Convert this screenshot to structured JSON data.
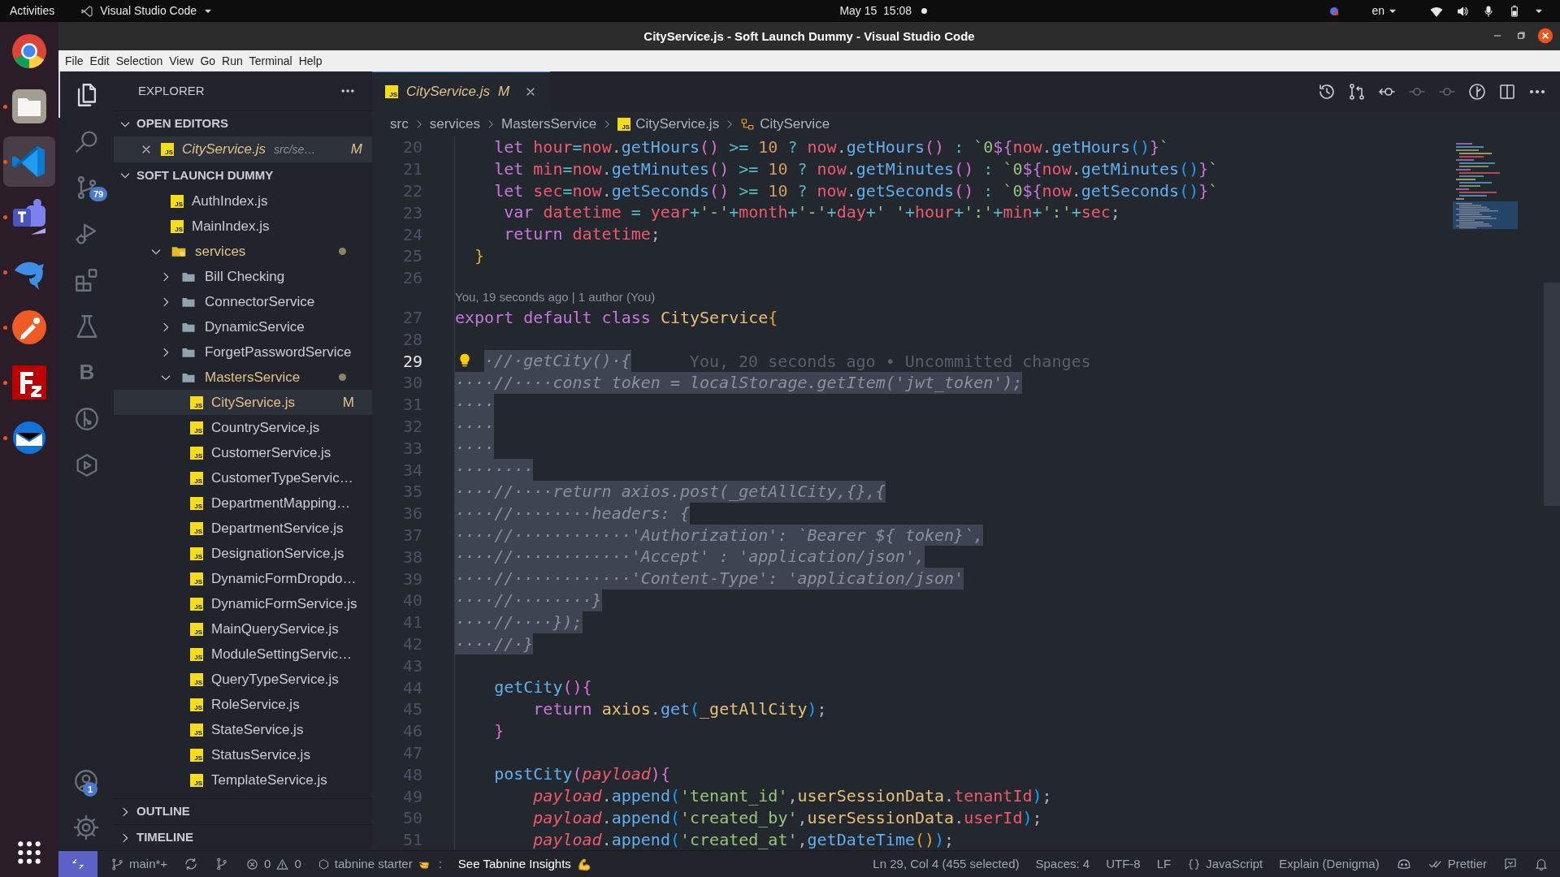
{
  "top_bar": {
    "activities": "Activities",
    "app_menu": "Visual Studio Code",
    "clock": "May 15  15:08",
    "language": "en"
  },
  "window": {
    "title": "CityService.js - Soft Launch Dummy - Visual Studio Code"
  },
  "dock": [
    {
      "kind": "browser",
      "running": false,
      "selected": false
    },
    {
      "kind": "files",
      "running": true,
      "selected": false
    },
    {
      "kind": "code",
      "running": true,
      "selected": true
    },
    {
      "kind": "chat",
      "running": true,
      "selected": false
    },
    {
      "kind": "dolphin",
      "running": true,
      "selected": false
    },
    {
      "kind": "api",
      "running": true,
      "selected": false
    },
    {
      "kind": "ftp",
      "running": true,
      "selected": false
    },
    {
      "kind": "mail",
      "running": true,
      "selected": false
    }
  ],
  "menu": [
    "File",
    "Edit",
    "Selection",
    "View",
    "Go",
    "Run",
    "Terminal",
    "Help"
  ],
  "activity_bar": [
    {
      "kind": "explorer",
      "selected": true
    },
    {
      "kind": "search",
      "selected": false
    },
    {
      "kind": "source-control",
      "selected": false,
      "badge": "79"
    },
    {
      "kind": "debug",
      "selected": false
    },
    {
      "kind": "extensions",
      "selected": false
    },
    {
      "kind": "testing",
      "selected": false
    },
    {
      "kind": "letter",
      "selected": false,
      "glyph": "B"
    },
    {
      "kind": "git-graph",
      "selected": false
    },
    {
      "kind": "hexagon",
      "selected": false
    }
  ],
  "activity_bar_bottom": [
    {
      "kind": "accounts",
      "badge": "1"
    },
    {
      "kind": "settings"
    }
  ],
  "sidebar": {
    "title": "EXPLORER",
    "open_editors": {
      "label": "OPEN EDITORS",
      "expanded": true,
      "items": [
        {
          "name": "CityService.js",
          "file_icon_text": "JS",
          "path": "src/se…",
          "status": "M",
          "selected": true
        }
      ]
    },
    "project": {
      "label": "SOFT LAUNCH DUMMY",
      "expanded": true,
      "tree": [
        {
          "kind": "file",
          "name": "AuthIndex.js",
          "file_icon_text": "JS",
          "modified": false,
          "selected": false
        },
        {
          "kind": "file",
          "name": "MainIndex.js",
          "file_icon_text": "JS",
          "modified": false,
          "selected": false
        },
        {
          "kind": "special-folder",
          "name": "services",
          "modified": true,
          "expanded": true,
          "selected": false,
          "children": [
            {
              "kind": "folder",
              "name": "Bill Checking",
              "modified": false,
              "expanded": false,
              "selected": false
            },
            {
              "kind": "folder",
              "name": "ConnectorService",
              "modified": false,
              "expanded": false,
              "selected": false
            },
            {
              "kind": "folder",
              "name": "DynamicService",
              "modified": false,
              "expanded": false,
              "selected": false
            },
            {
              "kind": "folder",
              "name": "ForgetPasswordService",
              "modified": false,
              "expanded": false,
              "selected": false
            },
            {
              "kind": "folder",
              "name": "MastersService",
              "modified": true,
              "expanded": true,
              "selected": false,
              "children": [
                {
                  "kind": "file",
                  "name": "CityService.js",
                  "file_icon_text": "JS",
                  "modified": true,
                  "status": "M",
                  "selected": true
                },
                {
                  "kind": "file",
                  "name": "CountryService.js",
                  "file_icon_text": "JS",
                  "modified": false,
                  "selected": false
                },
                {
                  "kind": "file",
                  "name": "CustomerService.js",
                  "file_icon_text": "JS",
                  "modified": false,
                  "selected": false
                },
                {
                  "kind": "file",
                  "name": "CustomerTypeServic…",
                  "file_icon_text": "JS",
                  "modified": false,
                  "selected": false
                },
                {
                  "kind": "file",
                  "name": "DepartmentMapping…",
                  "file_icon_text": "JS",
                  "modified": false,
                  "selected": false
                },
                {
                  "kind": "file",
                  "name": "DepartmentService.js",
                  "file_icon_text": "JS",
                  "modified": false,
                  "selected": false
                },
                {
                  "kind": "file",
                  "name": "DesignationService.js",
                  "file_icon_text": "JS",
                  "modified": false,
                  "selected": false
                },
                {
                  "kind": "file",
                  "name": "DynamicFormDropdo…",
                  "file_icon_text": "JS",
                  "modified": false,
                  "selected": false
                },
                {
                  "kind": "file",
                  "name": "DynamicFormService.js",
                  "file_icon_text": "JS",
                  "modified": false,
                  "selected": false
                },
                {
                  "kind": "file",
                  "name": "MainQueryService.js",
                  "file_icon_text": "JS",
                  "modified": false,
                  "selected": false
                },
                {
                  "kind": "file",
                  "name": "ModuleSettingServic…",
                  "file_icon_text": "JS",
                  "modified": false,
                  "selected": false
                },
                {
                  "kind": "file",
                  "name": "QueryTypeService.js",
                  "file_icon_text": "JS",
                  "modified": false,
                  "selected": false
                },
                {
                  "kind": "file",
                  "name": "RoleService.js",
                  "file_icon_text": "JS",
                  "modified": false,
                  "selected": false
                },
                {
                  "kind": "file",
                  "name": "StateService.js",
                  "file_icon_text": "JS",
                  "modified": false,
                  "selected": false
                },
                {
                  "kind": "file",
                  "name": "StatusService.js",
                  "file_icon_text": "JS",
                  "modified": false,
                  "selected": false
                },
                {
                  "kind": "file",
                  "name": "TemplateService.js",
                  "file_icon_text": "JS",
                  "modified": false,
                  "selected": false
                }
              ]
            }
          ]
        }
      ]
    },
    "sections": [
      {
        "label": "OUTLINE",
        "expanded": false
      },
      {
        "label": "TIMELINE",
        "expanded": false
      }
    ]
  },
  "tabs": [
    {
      "name": "CityService.js",
      "file_icon_text": "JS",
      "status": "M",
      "selected": true
    }
  ],
  "editor_actions": [
    {
      "kind": "history"
    },
    {
      "kind": "compare"
    },
    {
      "kind": "back"
    },
    {
      "kind": "previous-change"
    },
    {
      "kind": "next-change"
    },
    {
      "kind": "blame"
    },
    {
      "kind": "split"
    },
    {
      "kind": "more"
    }
  ],
  "breadcrumb": [
    {
      "kind": "folder",
      "label": "src"
    },
    {
      "kind": "folder",
      "label": "services"
    },
    {
      "kind": "folder",
      "label": "MastersService"
    },
    {
      "kind": "file",
      "label": "CityService.js",
      "file_icon_text": "JS"
    },
    {
      "kind": "class",
      "label": "CityService"
    }
  ],
  "editor": {
    "lines": [
      {
        "kind": "code",
        "number": "20",
        "selected": false,
        "current": false,
        "lightbulb": false,
        "segments": [
          {
            "kind": "kw",
            "text": "    let "
          },
          {
            "kind": "var",
            "text": "hour"
          },
          {
            "kind": "op",
            "text": "="
          },
          {
            "kind": "var",
            "text": "now"
          },
          {
            "kind": "p",
            "text": "."
          },
          {
            "kind": "fn",
            "text": "getHours"
          },
          {
            "kind": "b2",
            "text": "()"
          },
          {
            "kind": "op",
            "text": " >= "
          },
          {
            "kind": "num",
            "text": "10"
          },
          {
            "kind": "op",
            "text": " ? "
          },
          {
            "kind": "var",
            "text": "now"
          },
          {
            "kind": "p",
            "text": "."
          },
          {
            "kind": "fn",
            "text": "getHours"
          },
          {
            "kind": "b2",
            "text": "()"
          },
          {
            "kind": "op",
            "text": " : "
          },
          {
            "kind": "str",
            "text": "`0"
          },
          {
            "kind": "kw",
            "text": "${"
          },
          {
            "kind": "var",
            "text": "now"
          },
          {
            "kind": "p",
            "text": "."
          },
          {
            "kind": "fn",
            "text": "getHours"
          },
          {
            "kind": "b3",
            "text": "()"
          },
          {
            "kind": "kw",
            "text": "}"
          },
          {
            "kind": "str",
            "text": "`"
          }
        ]
      },
      {
        "kind": "code",
        "number": "21",
        "selected": false,
        "current": false,
        "lightbulb": false,
        "segments": [
          {
            "kind": "kw",
            "text": "    let "
          },
          {
            "kind": "var",
            "text": "min"
          },
          {
            "kind": "op",
            "text": "="
          },
          {
            "kind": "var",
            "text": "now"
          },
          {
            "kind": "p",
            "text": "."
          },
          {
            "kind": "fn",
            "text": "getMinutes"
          },
          {
            "kind": "b2",
            "text": "()"
          },
          {
            "kind": "op",
            "text": " >= "
          },
          {
            "kind": "num",
            "text": "10"
          },
          {
            "kind": "op",
            "text": " ? "
          },
          {
            "kind": "var",
            "text": "now"
          },
          {
            "kind": "p",
            "text": "."
          },
          {
            "kind": "fn",
            "text": "getMinutes"
          },
          {
            "kind": "b2",
            "text": "()"
          },
          {
            "kind": "op",
            "text": " : "
          },
          {
            "kind": "str",
            "text": "`0"
          },
          {
            "kind": "kw",
            "text": "${"
          },
          {
            "kind": "var",
            "text": "now"
          },
          {
            "kind": "p",
            "text": "."
          },
          {
            "kind": "fn",
            "text": "getMinutes"
          },
          {
            "kind": "b3",
            "text": "()"
          },
          {
            "kind": "kw",
            "text": "}"
          },
          {
            "kind": "str",
            "text": "`"
          }
        ]
      },
      {
        "kind": "code",
        "number": "22",
        "selected": false,
        "current": false,
        "lightbulb": false,
        "segments": [
          {
            "kind": "kw",
            "text": "    let "
          },
          {
            "kind": "var",
            "text": "sec"
          },
          {
            "kind": "op",
            "text": "="
          },
          {
            "kind": "var",
            "text": "now"
          },
          {
            "kind": "p",
            "text": "."
          },
          {
            "kind": "fn",
            "text": "getSeconds"
          },
          {
            "kind": "b2",
            "text": "()"
          },
          {
            "kind": "op",
            "text": " >= "
          },
          {
            "kind": "num",
            "text": "10"
          },
          {
            "kind": "op",
            "text": " ? "
          },
          {
            "kind": "var",
            "text": "now"
          },
          {
            "kind": "p",
            "text": "."
          },
          {
            "kind": "fn",
            "text": "getSeconds"
          },
          {
            "kind": "b2",
            "text": "()"
          },
          {
            "kind": "op",
            "text": " : "
          },
          {
            "kind": "str",
            "text": "`0"
          },
          {
            "kind": "kw",
            "text": "${"
          },
          {
            "kind": "var",
            "text": "now"
          },
          {
            "kind": "p",
            "text": "."
          },
          {
            "kind": "fn",
            "text": "getSeconds"
          },
          {
            "kind": "b3",
            "text": "()"
          },
          {
            "kind": "kw",
            "text": "}"
          },
          {
            "kind": "str",
            "text": "`"
          }
        ]
      },
      {
        "kind": "code",
        "number": "23",
        "selected": false,
        "current": false,
        "lightbulb": false,
        "segments": [
          {
            "kind": "kw",
            "text": "     var "
          },
          {
            "kind": "var",
            "text": "datetime"
          },
          {
            "kind": "op",
            "text": " = "
          },
          {
            "kind": "var",
            "text": "year"
          },
          {
            "kind": "op",
            "text": "+"
          },
          {
            "kind": "str",
            "text": "'-'"
          },
          {
            "kind": "op",
            "text": "+"
          },
          {
            "kind": "var",
            "text": "month"
          },
          {
            "kind": "op",
            "text": "+"
          },
          {
            "kind": "str",
            "text": "'-'"
          },
          {
            "kind": "op",
            "text": "+"
          },
          {
            "kind": "var",
            "text": "day"
          },
          {
            "kind": "op",
            "text": "+"
          },
          {
            "kind": "str",
            "text": "' '"
          },
          {
            "kind": "op",
            "text": "+"
          },
          {
            "kind": "var",
            "text": "hour"
          },
          {
            "kind": "op",
            "text": "+"
          },
          {
            "kind": "str",
            "text": "':'"
          },
          {
            "kind": "op",
            "text": "+"
          },
          {
            "kind": "var",
            "text": "min"
          },
          {
            "kind": "op",
            "text": "+"
          },
          {
            "kind": "str",
            "text": "':'"
          },
          {
            "kind": "op",
            "text": "+"
          },
          {
            "kind": "var",
            "text": "sec"
          },
          {
            "kind": "p",
            "text": ";"
          }
        ]
      },
      {
        "kind": "code",
        "number": "24",
        "selected": false,
        "current": false,
        "lightbulb": false,
        "segments": [
          {
            "kind": "kw",
            "text": "     return "
          },
          {
            "kind": "var",
            "text": "datetime"
          },
          {
            "kind": "p",
            "text": ";"
          }
        ]
      },
      {
        "kind": "code",
        "number": "25",
        "selected": false,
        "current": false,
        "lightbulb": false,
        "segments": [
          {
            "kind": "b1",
            "text": "  }"
          }
        ]
      },
      {
        "kind": "code",
        "number": "26",
        "current": false,
        "lightbulb": false
      },
      {
        "kind": "codelens",
        "text": "You, 19 seconds ago | 1 author (You)"
      },
      {
        "kind": "code",
        "number": "27",
        "selected": false,
        "current": false,
        "lightbulb": false,
        "segments": [
          {
            "kind": "kw",
            "text": "export default class "
          },
          {
            "kind": "cls",
            "text": "CityService"
          },
          {
            "kind": "b1",
            "text": "{"
          }
        ]
      },
      {
        "kind": "code",
        "number": "28",
        "current": false,
        "lightbulb": false
      },
      {
        "kind": "code",
        "number": "29",
        "selected": true,
        "current": true,
        "lightbulb": true,
        "segments": [
          {
            "kind": "cm",
            "text": "·//·getCity()·{"
          },
          {
            "kind": "blame",
            "text": "      You, 20 seconds ago • Uncommitted changes"
          }
        ]
      },
      {
        "kind": "code",
        "number": "30",
        "selected": true,
        "current": false,
        "lightbulb": false,
        "segments": [
          {
            "kind": "cm",
            "text": "····//····const token = localStorage.getItem('jwt_token');"
          }
        ]
      },
      {
        "kind": "code",
        "number": "31",
        "selected": true,
        "current": false,
        "lightbulb": false,
        "segments": [
          {
            "kind": "cm",
            "text": "····"
          }
        ]
      },
      {
        "kind": "code",
        "number": "32",
        "selected": true,
        "current": false,
        "lightbulb": false,
        "segments": [
          {
            "kind": "cm",
            "text": "····"
          }
        ]
      },
      {
        "kind": "code",
        "number": "33",
        "selected": true,
        "current": false,
        "lightbulb": false,
        "segments": [
          {
            "kind": "cm",
            "text": "····"
          }
        ]
      },
      {
        "kind": "code",
        "number": "34",
        "selected": true,
        "current": false,
        "lightbulb": false,
        "segments": [
          {
            "kind": "cm",
            "text": "········"
          }
        ]
      },
      {
        "kind": "code",
        "number": "35",
        "selected": true,
        "current": false,
        "lightbulb": false,
        "segments": [
          {
            "kind": "cm",
            "text": "····//····return axios.post(_getAllCity,{},{"
          }
        ]
      },
      {
        "kind": "code",
        "number": "36",
        "selected": true,
        "current": false,
        "lightbulb": false,
        "segments": [
          {
            "kind": "cm",
            "text": "····//········headers: {"
          }
        ]
      },
      {
        "kind": "code",
        "number": "37",
        "selected": true,
        "current": false,
        "lightbulb": false,
        "segments": [
          {
            "kind": "cm",
            "text": "····//············'Authorization': `Bearer ${ token}`,"
          }
        ]
      },
      {
        "kind": "code",
        "number": "38",
        "selected": true,
        "current": false,
        "lightbulb": false,
        "segments": [
          {
            "kind": "cm",
            "text": "····//············'Accept' : 'application/json',"
          }
        ]
      },
      {
        "kind": "code",
        "number": "39",
        "selected": true,
        "current": false,
        "lightbulb": false,
        "segments": [
          {
            "kind": "cm",
            "text": "····//············'Content-Type': 'application/json'"
          }
        ]
      },
      {
        "kind": "code",
        "number": "40",
        "selected": true,
        "current": false,
        "lightbulb": false,
        "segments": [
          {
            "kind": "cm",
            "text": "····//········}"
          }
        ]
      },
      {
        "kind": "code",
        "number": "41",
        "selected": true,
        "current": false,
        "lightbulb": false,
        "segments": [
          {
            "kind": "cm",
            "text": "····//····});"
          }
        ]
      },
      {
        "kind": "code",
        "number": "42",
        "selected": true,
        "current": false,
        "lightbulb": false,
        "segments": [
          {
            "kind": "cm",
            "text": "····//·}"
          }
        ]
      },
      {
        "kind": "code",
        "number": "43",
        "current": false,
        "lightbulb": false
      },
      {
        "kind": "code",
        "number": "44",
        "selected": false,
        "current": false,
        "lightbulb": false,
        "segments": [
          {
            "kind": "fn",
            "text": "    getCity"
          },
          {
            "kind": "b2",
            "text": "(){"
          }
        ]
      },
      {
        "kind": "code",
        "number": "45",
        "selected": false,
        "current": false,
        "lightbulb": false,
        "segments": [
          {
            "kind": "kw",
            "text": "        return "
          },
          {
            "kind": "cls",
            "text": "axios"
          },
          {
            "kind": "p",
            "text": "."
          },
          {
            "kind": "fn",
            "text": "get"
          },
          {
            "kind": "b3",
            "text": "("
          },
          {
            "kind": "cls",
            "text": "_getAllCity"
          },
          {
            "kind": "b3",
            "text": ")"
          },
          {
            "kind": "p",
            "text": ";"
          }
        ]
      },
      {
        "kind": "code",
        "number": "46",
        "selected": false,
        "current": false,
        "lightbulb": false,
        "segments": [
          {
            "kind": "b2",
            "text": "    }"
          }
        ]
      },
      {
        "kind": "code",
        "number": "47",
        "current": false,
        "lightbulb": false
      },
      {
        "kind": "code",
        "number": "48",
        "selected": false,
        "current": false,
        "lightbulb": false,
        "segments": [
          {
            "kind": "fn",
            "text": "    postCity"
          },
          {
            "kind": "b2",
            "text": "("
          },
          {
            "kind": "param",
            "text": "payload"
          },
          {
            "kind": "b2",
            "text": "){"
          }
        ]
      },
      {
        "kind": "code",
        "number": "49",
        "selected": false,
        "current": false,
        "lightbulb": false,
        "segments": [
          {
            "kind": "param",
            "text": "        payload"
          },
          {
            "kind": "p",
            "text": "."
          },
          {
            "kind": "fn",
            "text": "append"
          },
          {
            "kind": "b3",
            "text": "("
          },
          {
            "kind": "str",
            "text": "'tenant_id'"
          },
          {
            "kind": "p",
            "text": ","
          },
          {
            "kind": "cls",
            "text": "userSessionData"
          },
          {
            "kind": "p",
            "text": "."
          },
          {
            "kind": "var",
            "text": "tenantId"
          },
          {
            "kind": "b3",
            "text": ")"
          },
          {
            "kind": "p",
            "text": ";"
          }
        ]
      },
      {
        "kind": "code",
        "number": "50",
        "selected": false,
        "current": false,
        "lightbulb": false,
        "segments": [
          {
            "kind": "param",
            "text": "        payload"
          },
          {
            "kind": "p",
            "text": "."
          },
          {
            "kind": "fn",
            "text": "append"
          },
          {
            "kind": "b3",
            "text": "("
          },
          {
            "kind": "str",
            "text": "'created_by'"
          },
          {
            "kind": "p",
            "text": ","
          },
          {
            "kind": "cls",
            "text": "userSessionData"
          },
          {
            "kind": "p",
            "text": "."
          },
          {
            "kind": "var",
            "text": "userId"
          },
          {
            "kind": "b3",
            "text": ")"
          },
          {
            "kind": "p",
            "text": ";"
          }
        ]
      },
      {
        "kind": "code",
        "number": "51",
        "selected": false,
        "current": false,
        "lightbulb": false,
        "segments": [
          {
            "kind": "param",
            "text": "        payload"
          },
          {
            "kind": "p",
            "text": "."
          },
          {
            "kind": "fn",
            "text": "append"
          },
          {
            "kind": "b3",
            "text": "("
          },
          {
            "kind": "str",
            "text": "'created_at'"
          },
          {
            "kind": "p",
            "text": ","
          },
          {
            "kind": "fn",
            "text": "getDateTime"
          },
          {
            "kind": "b1",
            "text": "()"
          },
          {
            "kind": "b3",
            "text": ")"
          },
          {
            "kind": "p",
            "text": ";"
          }
        ]
      }
    ]
  },
  "status_bar": {
    "left": [
      {
        "kind": "remote"
      },
      {
        "kind": "branch",
        "label": "main*+"
      },
      {
        "kind": "sync"
      },
      {
        "kind": "graph"
      },
      {
        "kind": "problems",
        "errors": "0",
        "warnings": "0"
      },
      {
        "kind": "tabnine",
        "label": "tabnine starter",
        "suffix": ":"
      },
      {
        "kind": "insights",
        "label": "See Tabnine Insights"
      }
    ],
    "right": [
      {
        "kind": "text",
        "label": "Ln 29, Col 4 (455 selected)"
      },
      {
        "kind": "text",
        "label": "Spaces: 4"
      },
      {
        "kind": "text",
        "label": "UTF-8"
      },
      {
        "kind": "text",
        "label": "LF"
      },
      {
        "kind": "language",
        "label": "JavaScript"
      },
      {
        "kind": "text",
        "label": "Explain (Denigma)"
      },
      {
        "kind": "copilot"
      },
      {
        "kind": "prettier",
        "label": "Prettier"
      },
      {
        "kind": "feedback"
      },
      {
        "kind": "bell"
      }
    ]
  }
}
